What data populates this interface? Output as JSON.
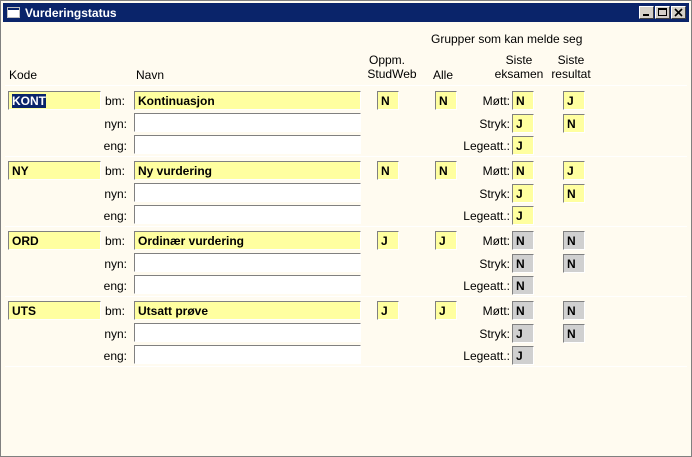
{
  "window": {
    "title": "Vurderingstatus"
  },
  "headers": {
    "kode": "Kode",
    "navn": "Navn",
    "oppm1": "Oppm.",
    "oppm2": "StudWeb",
    "grupper": "Grupper som kan melde seg",
    "alle": "Alle",
    "siste_eks1": "Siste",
    "siste_eks2": "eksamen",
    "siste_res1": "Siste",
    "siste_res2": "resultat"
  },
  "lang_labels": {
    "bm": "bm:",
    "nyn": "nyn:",
    "eng": "eng:"
  },
  "status_labels": {
    "mott": "Møtt:",
    "stryk": "Stryk:",
    "legeatt": "Legeatt.:"
  },
  "records": [
    {
      "kode": "KONT",
      "bm": "Kontinuasjon",
      "nyn": "",
      "eng": "",
      "oppm": "N",
      "alle": "N",
      "mott_eks": "N",
      "mott_res": "J",
      "stryk_eks": "J",
      "stryk_res": "N",
      "legeatt_eks": "J"
    },
    {
      "kode": "NY",
      "bm": "Ny vurdering",
      "nyn": "",
      "eng": "",
      "oppm": "N",
      "alle": "N",
      "mott_eks": "N",
      "mott_res": "J",
      "stryk_eks": "J",
      "stryk_res": "N",
      "legeatt_eks": "J"
    },
    {
      "kode": "ORD",
      "bm": "Ordinær vurdering",
      "nyn": "",
      "eng": "",
      "oppm": "J",
      "alle": "J",
      "mott_eks": "N",
      "mott_res": "N",
      "stryk_eks": "N",
      "stryk_res": "N",
      "legeatt_eks": "N"
    },
    {
      "kode": "UTS",
      "bm": "Utsatt prøve",
      "nyn": "",
      "eng": "",
      "oppm": "J",
      "alle": "J",
      "mott_eks": "N",
      "mott_res": "N",
      "stryk_eks": "J",
      "stryk_res": "N",
      "legeatt_eks": "J"
    }
  ]
}
